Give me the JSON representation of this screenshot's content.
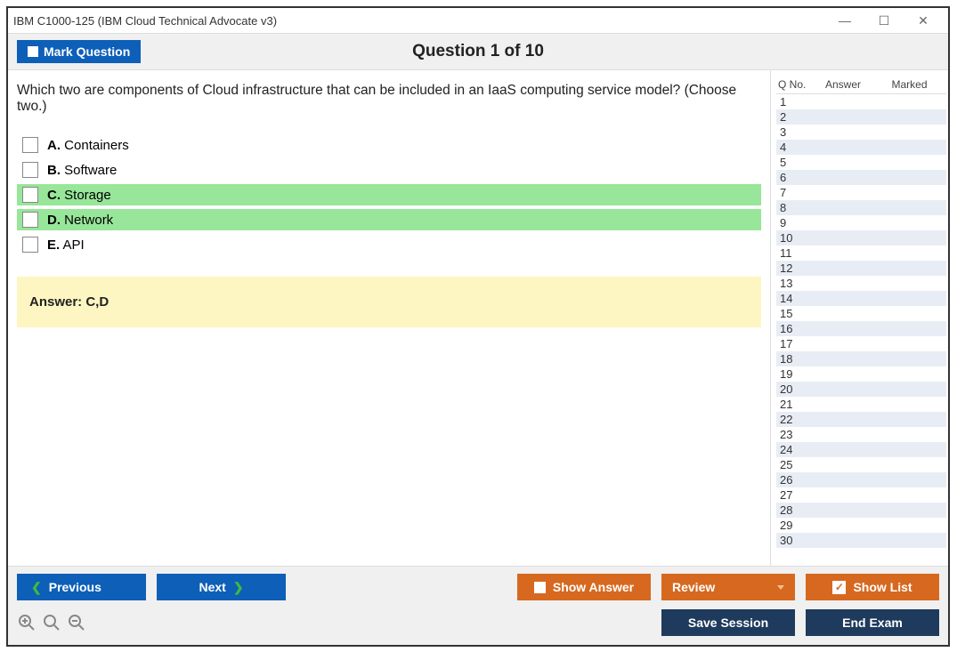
{
  "window": {
    "title": "IBM C1000-125 (IBM Cloud Technical Advocate v3)"
  },
  "header": {
    "mark_label": "Mark Question",
    "question_counter": "Question 1 of 10"
  },
  "question": {
    "text": "Which two are components of Cloud infrastructure that can be included in an IaaS computing service model? (Choose two.)",
    "options": [
      {
        "letter": "A.",
        "text": "Containers",
        "correct": false
      },
      {
        "letter": "B.",
        "text": "Software",
        "correct": false
      },
      {
        "letter": "C.",
        "text": "Storage",
        "correct": true
      },
      {
        "letter": "D.",
        "text": "Network",
        "correct": true
      },
      {
        "letter": "E.",
        "text": "API",
        "correct": false
      }
    ],
    "answer_text": "Answer: C,D"
  },
  "sidebar": {
    "headers": {
      "qno": "Q No.",
      "answer": "Answer",
      "marked": "Marked"
    },
    "rows": [
      {
        "n": "1"
      },
      {
        "n": "2"
      },
      {
        "n": "3"
      },
      {
        "n": "4"
      },
      {
        "n": "5"
      },
      {
        "n": "6"
      },
      {
        "n": "7"
      },
      {
        "n": "8"
      },
      {
        "n": "9"
      },
      {
        "n": "10"
      },
      {
        "n": "11"
      },
      {
        "n": "12"
      },
      {
        "n": "13"
      },
      {
        "n": "14"
      },
      {
        "n": "15"
      },
      {
        "n": "16"
      },
      {
        "n": "17"
      },
      {
        "n": "18"
      },
      {
        "n": "19"
      },
      {
        "n": "20"
      },
      {
        "n": "21"
      },
      {
        "n": "22"
      },
      {
        "n": "23"
      },
      {
        "n": "24"
      },
      {
        "n": "25"
      },
      {
        "n": "26"
      },
      {
        "n": "27"
      },
      {
        "n": "28"
      },
      {
        "n": "29"
      },
      {
        "n": "30"
      }
    ]
  },
  "footer": {
    "previous": "Previous",
    "next": "Next",
    "show_answer": "Show Answer",
    "review": "Review",
    "show_list": "Show List",
    "save_session": "Save Session",
    "end_exam": "End Exam"
  }
}
